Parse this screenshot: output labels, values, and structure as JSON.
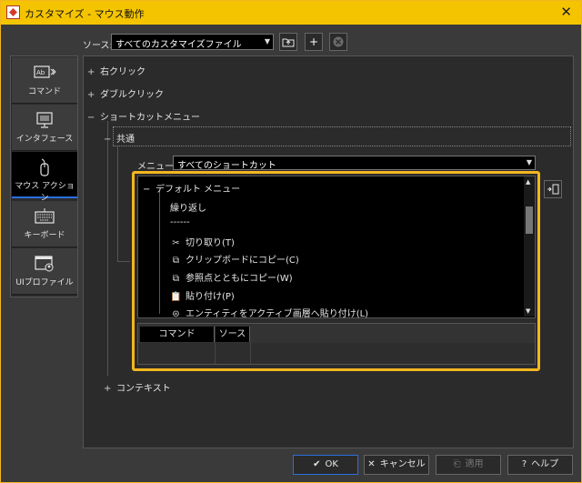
{
  "window": {
    "title": "カスタマイズ - マウス動作",
    "close_glyph": "✕"
  },
  "source": {
    "label": "ソース:",
    "value": "すべてのカスタマイズファイル",
    "buttons": {
      "export_icon": "folder-export-icon",
      "add": "+",
      "remove_icon": "remove-icon"
    }
  },
  "categories": [
    {
      "label": "コマンド",
      "icon": "command-icon"
    },
    {
      "label": "インタフェース",
      "icon": "interface-icon"
    },
    {
      "label": "マウス アクション",
      "icon": "mouse-icon",
      "active": true
    },
    {
      "label": "キーボード",
      "icon": "keyboard-icon"
    },
    {
      "label": "UIプロファイル",
      "icon": "ui-profile-icon"
    }
  ],
  "tree": {
    "right_click": {
      "toggle": "+",
      "label": "右クリック"
    },
    "double_click": {
      "toggle": "+",
      "label": "ダブルクリック"
    },
    "shortcut_menu": {
      "toggle": "−",
      "label": "ショートカットメニュー"
    },
    "common": {
      "toggle": "−",
      "label": "共通"
    },
    "context": {
      "toggle": "+",
      "label": "コンテキスト"
    }
  },
  "menu": {
    "label": "メニュー:",
    "value": "すべてのショートカット"
  },
  "menu_list": {
    "root": {
      "toggle": "−",
      "label": "デフォルト メニュー"
    },
    "items": [
      {
        "label": "繰り返し",
        "icon": ""
      },
      {
        "label": "------",
        "icon": ""
      },
      {
        "label": "切り取り(T)",
        "icon": "✂"
      },
      {
        "label": "クリップボードにコピー(C)",
        "icon": "⧉"
      },
      {
        "label": "参照点とともにコピー(W)",
        "icon": "⧉"
      },
      {
        "label": "貼り付け(P)",
        "icon": "📋"
      },
      {
        "label": "エンティティをアクティブ画層へ貼り付け(L)",
        "icon": "⊜"
      }
    ]
  },
  "command_table": {
    "headers": [
      "コマンド",
      "ソース"
    ]
  },
  "footer": {
    "ok": "OK",
    "cancel": "キャンセル",
    "apply": "適用",
    "help": "ヘルプ"
  },
  "colors": {
    "accent": "#f5c400",
    "highlight": "#f3b61f",
    "selection": "#2b6fdf"
  }
}
